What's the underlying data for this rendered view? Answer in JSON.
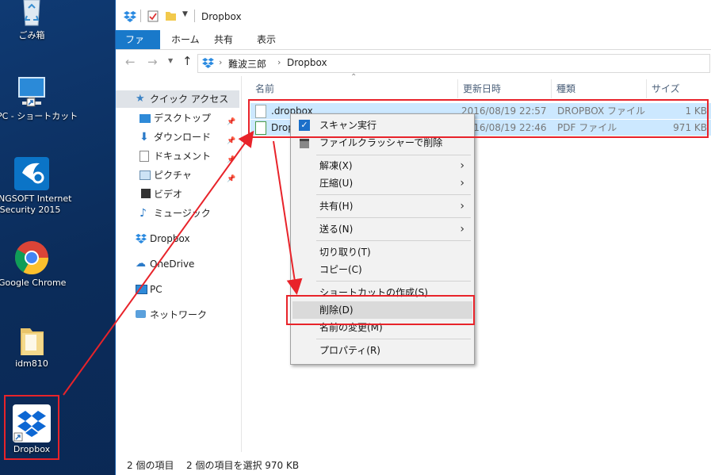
{
  "desktop": {
    "icons": [
      {
        "label": "ごみ箱"
      },
      {
        "label": "PC - ショートカット"
      },
      {
        "label": "NGSOFT Internet"
      },
      {
        "label": "Security 2015"
      },
      {
        "label": "Google Chrome"
      },
      {
        "label": "idm810"
      },
      {
        "label": "Dropbox"
      }
    ]
  },
  "explorer": {
    "title": "Dropbox",
    "tabs": [
      "ファイル",
      "ホーム",
      "共有",
      "表示"
    ],
    "breadcrumb": [
      "難波三郎",
      "Dropbox"
    ],
    "nav": [
      {
        "label": "クイック アクセス",
        "icon": "star-icon"
      },
      {
        "label": "デスクトップ",
        "icon": "desktop-icon"
      },
      {
        "label": "ダウンロード",
        "icon": "download-icon"
      },
      {
        "label": "ドキュメント",
        "icon": "document-icon"
      },
      {
        "label": "ピクチャ",
        "icon": "picture-icon"
      },
      {
        "label": "ビデオ",
        "icon": "video-icon"
      },
      {
        "label": "ミュージック",
        "icon": "music-icon"
      },
      {
        "label": "Dropbox",
        "icon": "dropbox-icon"
      },
      {
        "label": "OneDrive",
        "icon": "onedrive-icon"
      },
      {
        "label": "PC",
        "icon": "pc-icon"
      },
      {
        "label": "ネットワーク",
        "icon": "network-icon"
      }
    ],
    "columns": [
      "名前",
      "更新日時",
      "種類",
      "サイズ"
    ],
    "files": [
      {
        "name": ".dropbox",
        "date": "2016/08/19 22:57",
        "type": "DROPBOX ファイル",
        "size": "1 KB"
      },
      {
        "name": "Drop",
        "date": "2016/08/19 22:46",
        "type": "PDF ファイル",
        "size": "971 KB"
      }
    ],
    "status": {
      "count": "2 個の項目",
      "selected": "2 個の項目を選択 970 KB"
    }
  },
  "context_menu": {
    "items": [
      {
        "label": "スキャン実行"
      },
      {
        "label": "ファイルクラッシャーで削除"
      },
      {
        "label": "解凍(X)"
      },
      {
        "label": "圧縮(U)"
      },
      {
        "label": "共有(H)"
      },
      {
        "label": "送る(N)"
      },
      {
        "label": "切り取り(T)"
      },
      {
        "label": "コピー(C)"
      },
      {
        "label": "ショートカットの作成(S)"
      },
      {
        "label": "削除(D)"
      },
      {
        "label": "名前の変更(M)"
      },
      {
        "label": "プロパティ(R)"
      }
    ]
  },
  "colors": {
    "accent": "#1979ca",
    "highlight": "#e8232a",
    "selection": "#cce8ff"
  }
}
